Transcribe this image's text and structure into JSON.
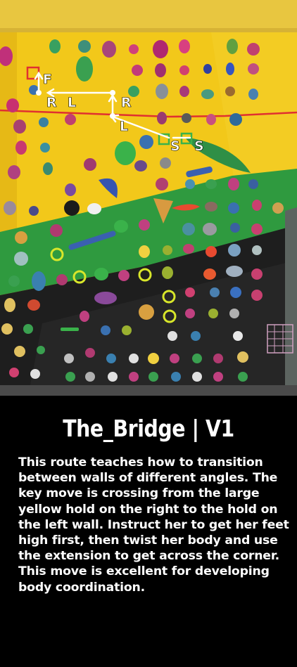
{
  "route": {
    "title": "The_Bridge | V1",
    "description": "This route teaches how to transition between walls of different angles. The key move is crossing from the large yellow hold on the right to the hold on the left wall. Instruct her to get her feet high first, then twist her body and use the extension to get across the corner. This move is excellent for developing body coordination."
  },
  "annotations": {
    "finish": "F",
    "move_labels": [
      "R",
      "L",
      "R",
      "L",
      "S",
      "S"
    ]
  },
  "colors": {
    "wall_yellow": "#f2c81a",
    "wall_green": "#2f9a3f",
    "wall_dark": "#1e1e1e",
    "route_marker": "#d8e62a",
    "arrow": "#ffffff",
    "start_marker": "#3ab24a"
  }
}
